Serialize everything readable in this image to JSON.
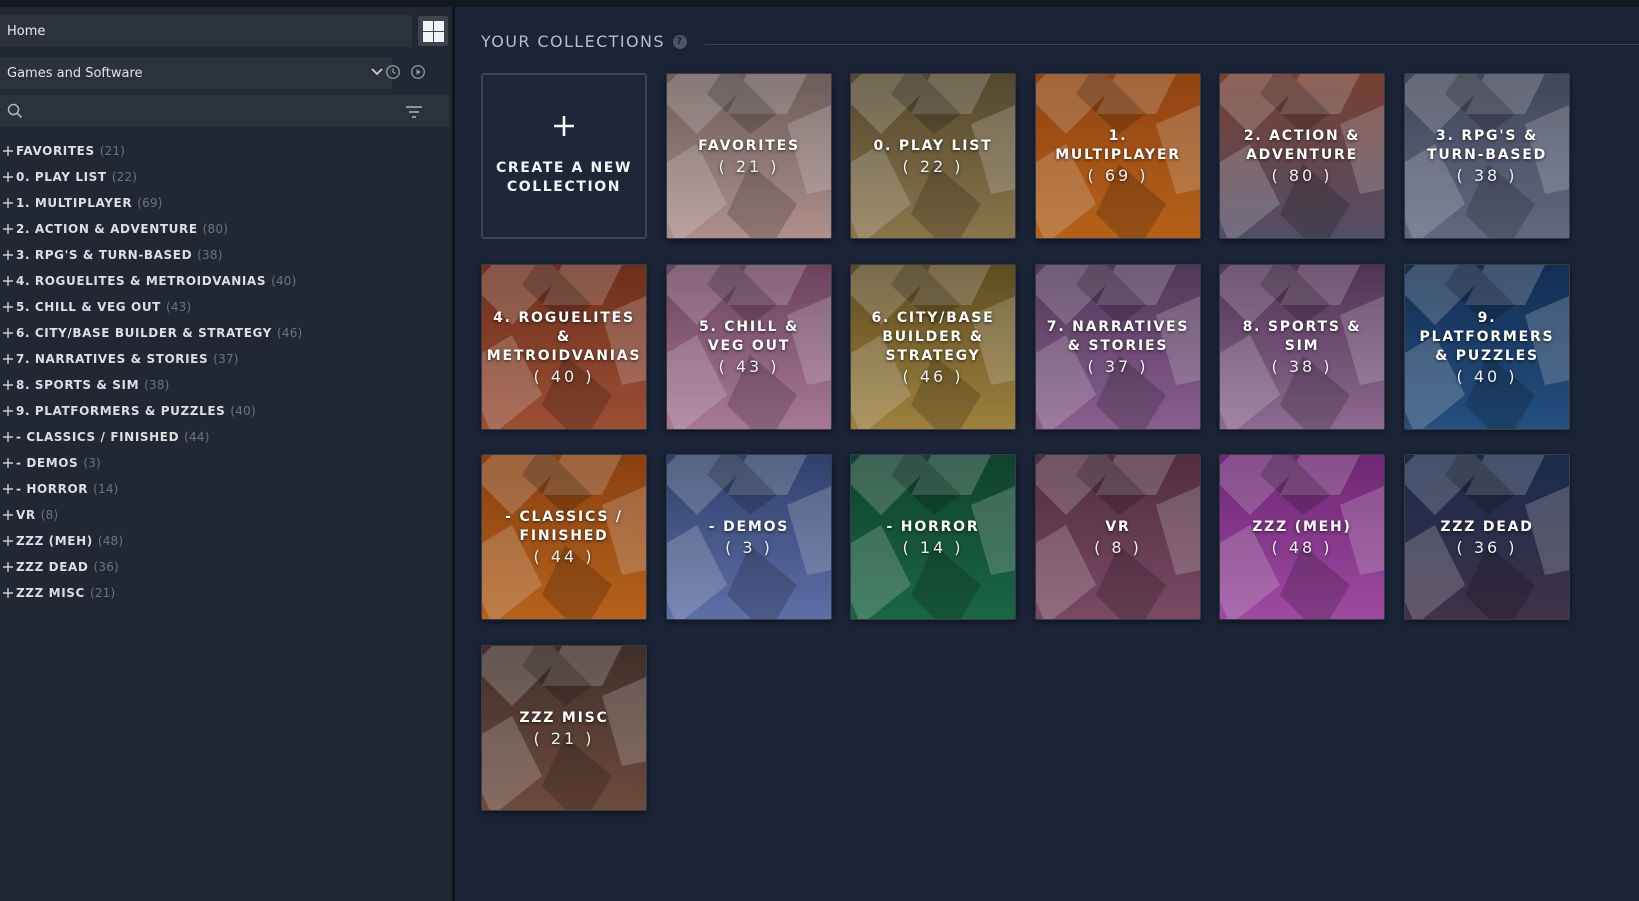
{
  "sidebar": {
    "home_label": "Home",
    "filter_selected": "Games and Software",
    "search_placeholder": "",
    "collections": [
      {
        "name": "FAVORITES",
        "count": "(21)"
      },
      {
        "name": "0. PLAY LIST",
        "count": "(22)"
      },
      {
        "name": "1. MULTIPLAYER",
        "count": "(69)"
      },
      {
        "name": "2. ACTION & ADVENTURE",
        "count": "(80)"
      },
      {
        "name": "3. RPG'S & TURN-BASED",
        "count": "(38)"
      },
      {
        "name": "4. ROGUELITES & METROIDVANIAS",
        "count": "(40)"
      },
      {
        "name": "5. CHILL & VEG OUT",
        "count": "(43)"
      },
      {
        "name": "6. CITY/BASE BUILDER & STRATEGY",
        "count": "(46)"
      },
      {
        "name": "7. NARRATIVES & STORIES",
        "count": "(37)"
      },
      {
        "name": "8. SPORTS & SIM",
        "count": "(38)"
      },
      {
        "name": "9. PLATFORMERS & PUZZLES",
        "count": "(40)"
      },
      {
        "name": "- CLASSICS / FINISHED",
        "count": "(44)"
      },
      {
        "name": "- DEMOS",
        "count": "(3)"
      },
      {
        "name": "- HORROR",
        "count": "(14)"
      },
      {
        "name": "VR",
        "count": "(8)"
      },
      {
        "name": "ZZZ (MEH)",
        "count": "(48)"
      },
      {
        "name": "ZZZ DEAD",
        "count": "(36)"
      },
      {
        "name": "ZZZ MISC",
        "count": "(21)"
      }
    ]
  },
  "main": {
    "title": "YOUR COLLECTIONS",
    "help_symbol": "?",
    "create_label": "CREATE A NEW COLLECTION",
    "tiles": [
      {
        "name": "FAVORITES",
        "count": "( 21 )",
        "color_top": "#7a6a66",
        "color_bottom": "#c9a4a0"
      },
      {
        "name": "0. PLAY LIST",
        "count": "( 22 )",
        "color_top": "#5e5234",
        "color_bottom": "#a08656"
      },
      {
        "name": "1. MULTIPLAYER",
        "count": "( 69 )",
        "color_top": "#a54d13",
        "color_bottom": "#d0701e"
      },
      {
        "name": "2. ACTION & ADVENTURE",
        "count": "( 80 )",
        "color_top": "#8a4838",
        "color_bottom": "#5e5a77"
      },
      {
        "name": "3. RPG'S & TURN-BASED",
        "count": "( 38 )",
        "color_top": "#4a5166",
        "color_bottom": "#6f7896"
      },
      {
        "name": "4. ROGUELITES & METROIDVANIAS",
        "count": "( 40 )",
        "color_top": "#7d3621",
        "color_bottom": "#b25b3c"
      },
      {
        "name": "5. CHILL & VEG OUT",
        "count": "( 43 )",
        "color_top": "#7b4b6a",
        "color_bottom": "#c08bab"
      },
      {
        "name": "6. CITY/BASE BUILDER & STRATEGY",
        "count": "( 46 )",
        "color_top": "#6b5626",
        "color_bottom": "#b59446"
      },
      {
        "name": "7. NARRATIVES & STORIES",
        "count": "( 37 )",
        "color_top": "#5c3f68",
        "color_bottom": "#9d6da3"
      },
      {
        "name": "8. SPORTS & SIM",
        "count": "( 38 )",
        "color_top": "#5d3a62",
        "color_bottom": "#a37aa7"
      },
      {
        "name": "9. PLATFORMERS & PUZZLES",
        "count": "( 40 )",
        "color_top": "#16355f",
        "color_bottom": "#2a5b92"
      },
      {
        "name": "- CLASSICS / FINISHED",
        "count": "( 44 )",
        "color_top": "#9c4a13",
        "color_bottom": "#d0701f"
      },
      {
        "name": "- DEMOS",
        "count": "( 3 )",
        "color_top": "#354a7a",
        "color_bottom": "#6c7fc0"
      },
      {
        "name": "- HORROR",
        "count": "( 14 )",
        "color_top": "#134c35",
        "color_bottom": "#1e7550"
      },
      {
        "name": "VR",
        "count": "( 8 )",
        "color_top": "#5d3448",
        "color_bottom": "#8b5570"
      },
      {
        "name": "ZZZ (MEH)",
        "count": "( 48 )",
        "color_top": "#7d2d85",
        "color_bottom": "#b554b8"
      },
      {
        "name": "ZZZ DEAD",
        "count": "( 36 )",
        "color_top": "#1d3156",
        "color_bottom": "#4a3a54"
      },
      {
        "name": "ZZZ MISC",
        "count": "( 21 )",
        "color_top": "#4a3730",
        "color_bottom": "#7e5647"
      }
    ]
  },
  "colors": {
    "background": "#1b2436",
    "sidebar": "#222833",
    "accent_text": "#b8bec8"
  }
}
